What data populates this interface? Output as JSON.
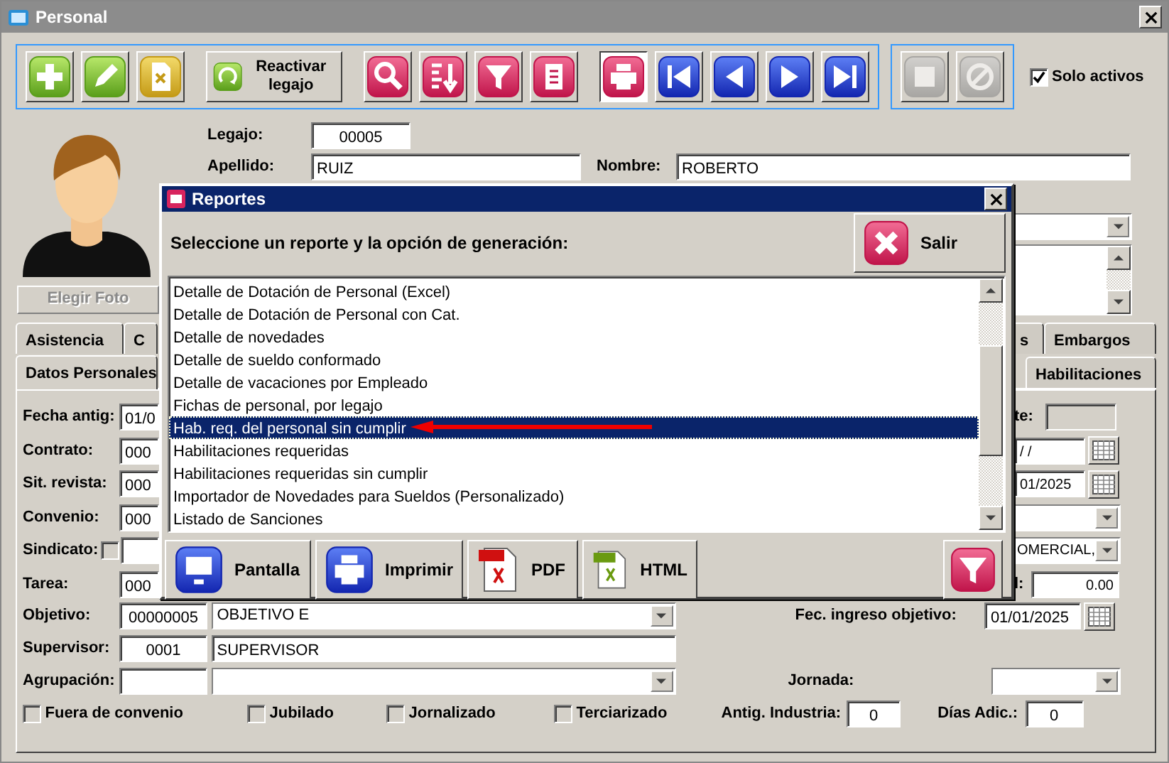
{
  "window": {
    "title": "Personal"
  },
  "toolbar_groups": [
    {
      "buttons": [
        {
          "kind": "add",
          "disabled": false,
          "pressed": false
        },
        {
          "kind": "edit",
          "disabled": false,
          "pressed": false
        },
        {
          "kind": "delete",
          "disabled": false,
          "pressed": false
        },
        {
          "kind": "reactivate",
          "label": "Reactivar legajo",
          "disabled": false,
          "pressed": false
        },
        {
          "kind": "search",
          "disabled": false,
          "pressed": false
        },
        {
          "kind": "sort",
          "disabled": false,
          "pressed": false
        },
        {
          "kind": "filter",
          "disabled": false,
          "pressed": false
        },
        {
          "kind": "report",
          "disabled": false,
          "pressed": false
        },
        {
          "kind": "print",
          "disabled": false,
          "pressed": true
        },
        {
          "kind": "first",
          "disabled": false,
          "pressed": false
        },
        {
          "kind": "prev",
          "disabled": false,
          "pressed": false
        },
        {
          "kind": "next",
          "disabled": false,
          "pressed": false
        },
        {
          "kind": "last",
          "disabled": false,
          "pressed": false
        }
      ]
    },
    {
      "buttons": [
        {
          "kind": "save",
          "disabled": true,
          "pressed": false
        },
        {
          "kind": "cancel",
          "disabled": true,
          "pressed": false
        }
      ]
    }
  ],
  "solo_activos": {
    "label": "Solo activos",
    "checked": true
  },
  "photo_button": {
    "label": "Elegir Foto",
    "disabled": true
  },
  "legajo": {
    "label": "Legajo:",
    "value": "00005"
  },
  "apellido": {
    "label": "Apellido:",
    "value": "RUIZ"
  },
  "nombre": {
    "label": "Nombre:",
    "value": "ROBERTO"
  },
  "tabs_row_1": [
    {
      "label": "Asistencia",
      "selected": false
    },
    {
      "label": "C",
      "selected": false
    },
    {
      "label": "s",
      "selected": false
    },
    {
      "label": "Embargos",
      "selected": false
    }
  ],
  "tabs_row_2": [
    {
      "label": "Datos Personales",
      "selected": true
    },
    {
      "label": "Habilitaciones",
      "selected": false
    }
  ],
  "left_fields": [
    {
      "kind": "field",
      "label": "Fecha antig:",
      "value": "01/0"
    },
    {
      "kind": "field",
      "label": "Contrato:",
      "value": "000"
    },
    {
      "kind": "field",
      "label": "Sit. revista:",
      "value": "000"
    },
    {
      "kind": "field",
      "label": "Convenio:",
      "value": "000"
    },
    {
      "kind": "check-field",
      "label": "Sindicato:",
      "checked": false
    },
    {
      "kind": "field",
      "label": "Tarea:",
      "value": "000"
    }
  ],
  "right_fields": [
    {
      "kind": "label-field",
      "label": "te:",
      "disabled": true
    },
    {
      "kind": "date",
      "value": "/ /"
    },
    {
      "kind": "date",
      "value": "01/2025"
    },
    {
      "kind": "combo"
    },
    {
      "kind": "combo",
      "value": "OMERCIAL,"
    },
    {
      "kind": "label-field",
      "label": "l:",
      "value": "0.00",
      "disabled": false
    }
  ],
  "objetivo": {
    "label": "Objetivo:",
    "code": "00000005",
    "name": "OBJETIVO E",
    "date_label": "Fec. ingreso objetivo:",
    "date": "01/01/2025"
  },
  "supervisor": {
    "label": "Supervisor:",
    "code": "0001",
    "name": "SUPERVISOR"
  },
  "agrupacion": {
    "label": "Agrupación:",
    "jornada_label": "Jornada:"
  },
  "checkboxes": [
    {
      "label": "Fuera de convenio",
      "checked": false
    },
    {
      "label": "Jubilado",
      "checked": false
    },
    {
      "label": "Jornalizado",
      "checked": false
    },
    {
      "label": "Terciarizado",
      "checked": false
    }
  ],
  "antig_industria": {
    "label": "Antig. Industria:",
    "value": "0"
  },
  "dias_adic": {
    "label": "Días Adic.:",
    "value": "0"
  },
  "dialog": {
    "title": "Reportes",
    "prompt": "Seleccione un reporte y la opción de generación:",
    "exit_label": "Salir",
    "reports": [
      {
        "label": "Detalle de Dotación de Personal (Excel)",
        "selected": false
      },
      {
        "label": "Detalle de Dotación de Personal con Cat.",
        "selected": false
      },
      {
        "label": "Detalle de novedades",
        "selected": false
      },
      {
        "label": "Detalle de sueldo conformado",
        "selected": false
      },
      {
        "label": "Detalle de vacaciones por Empleado",
        "selected": false
      },
      {
        "label": "Fichas de personal, por legajo",
        "selected": false
      },
      {
        "label": "Hab. req. del personal sin cumplir",
        "selected": true
      },
      {
        "label": "Habilitaciones requeridas",
        "selected": false
      },
      {
        "label": "Habilitaciones requeridas sin cumplir",
        "selected": false
      },
      {
        "label": "Importador de Novedades para Sueldos (Personalizado)",
        "selected": false
      },
      {
        "label": "Listado de Sanciones",
        "selected": false
      }
    ],
    "outputs": [
      {
        "kind": "screen",
        "label": "Pantalla"
      },
      {
        "kind": "printer",
        "label": "Imprimir"
      },
      {
        "kind": "pdf",
        "label": "PDF"
      },
      {
        "kind": "html",
        "label": "HTML"
      }
    ]
  }
}
